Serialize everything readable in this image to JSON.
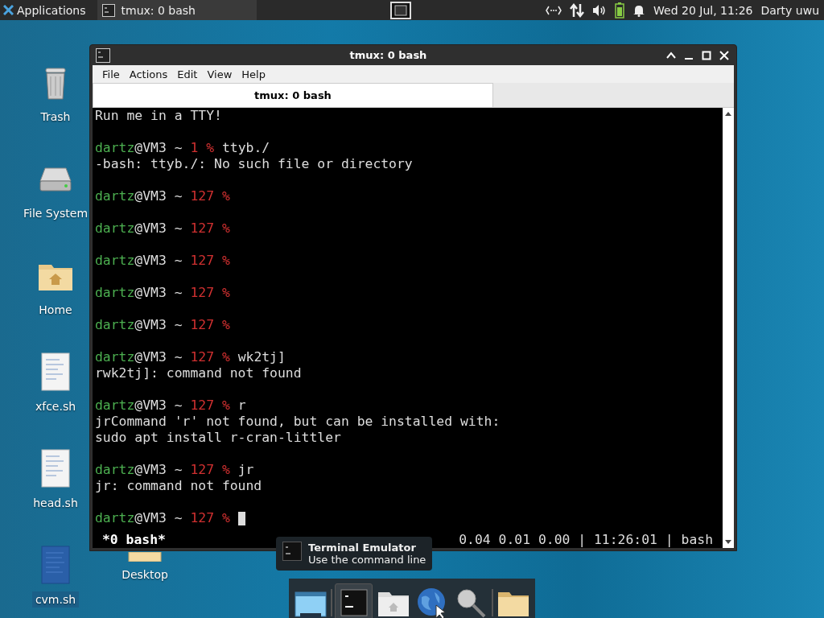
{
  "panel": {
    "applications": "Applications",
    "tasks": [
      {
        "label": "tmux: 0 bash",
        "selected": true
      }
    ],
    "clock": "Wed 20 Jul, 11:26",
    "user": "Darty uwu"
  },
  "desktop_icons": [
    {
      "kind": "trash",
      "label": "Trash",
      "selected": false
    },
    {
      "kind": "drive",
      "label": "File System",
      "selected": false
    },
    {
      "kind": "home",
      "label": "Home",
      "selected": false
    },
    {
      "kind": "script",
      "label": "xfce.sh",
      "selected": false
    },
    {
      "kind": "script",
      "label": "head.sh",
      "selected": false
    },
    {
      "kind": "bluedoc",
      "label": "cvm.sh",
      "selected": true
    },
    {
      "kind": "folder",
      "label": "Desktop",
      "selected": false
    }
  ],
  "window": {
    "title": "tmux: 0 bash",
    "menu": [
      "File",
      "Actions",
      "Edit",
      "View",
      "Help"
    ],
    "tabs": [
      {
        "label": "tmux: 0 bash",
        "selected": true
      }
    ],
    "terminal": [
      {
        "kind": "output",
        "text": "Run me in a TTY!"
      },
      {
        "kind": "blank"
      },
      {
        "kind": "prompt",
        "user": "dartz",
        "host": "@VM3 ~ ",
        "status": "1 %",
        "command": "ttyb./"
      },
      {
        "kind": "output",
        "text": "-bash: ttyb./: No such file or directory"
      },
      {
        "kind": "blank"
      },
      {
        "kind": "prompt",
        "user": "dartz",
        "host": "@VM3 ~ ",
        "status": "127 %"
      },
      {
        "kind": "blank"
      },
      {
        "kind": "prompt",
        "user": "dartz",
        "host": "@VM3 ~ ",
        "status": "127 %"
      },
      {
        "kind": "blank"
      },
      {
        "kind": "prompt",
        "user": "dartz",
        "host": "@VM3 ~ ",
        "status": "127 %"
      },
      {
        "kind": "blank"
      },
      {
        "kind": "prompt",
        "user": "dartz",
        "host": "@VM3 ~ ",
        "status": "127 %"
      },
      {
        "kind": "blank"
      },
      {
        "kind": "prompt",
        "user": "dartz",
        "host": "@VM3 ~ ",
        "status": "127 %"
      },
      {
        "kind": "blank"
      },
      {
        "kind": "prompt",
        "user": "dartz",
        "host": "@VM3 ~ ",
        "status": "127 %",
        "command": "wk2tj]"
      },
      {
        "kind": "output",
        "text": "rwk2tj]: command not found"
      },
      {
        "kind": "blank"
      },
      {
        "kind": "prompt",
        "user": "dartz",
        "host": "@VM3 ~ ",
        "status": "127 %",
        "command": "r"
      },
      {
        "kind": "output",
        "text": "jrCommand 'r' not found, but can be installed with:"
      },
      {
        "kind": "output",
        "text": "sudo apt install r-cran-littler"
      },
      {
        "kind": "blank"
      },
      {
        "kind": "prompt",
        "user": "dartz",
        "host": "@VM3 ~ ",
        "status": "127 %",
        "command": "jr"
      },
      {
        "kind": "output",
        "text": "jr: command not found"
      },
      {
        "kind": "blank"
      },
      {
        "kind": "prompt",
        "user": "dartz",
        "host": "@VM3 ~ ",
        "status": "127 %",
        "cursor": true
      }
    ],
    "tmux_status": {
      "left": "*0 bash*",
      "right": "0.04 0.01 0.00 | 11:26:01 | bash"
    }
  },
  "tooltip": {
    "title": "Terminal Emulator",
    "subtitle": "Use the command line"
  },
  "dock": [
    {
      "kind": "desktop",
      "selected": false
    },
    {
      "kind": "separator"
    },
    {
      "kind": "terminal",
      "selected": true
    },
    {
      "kind": "home",
      "selected": false
    },
    {
      "kind": "globe",
      "selected": false
    },
    {
      "kind": "search",
      "selected": false
    },
    {
      "kind": "separator"
    },
    {
      "kind": "folder",
      "selected": false
    }
  ]
}
